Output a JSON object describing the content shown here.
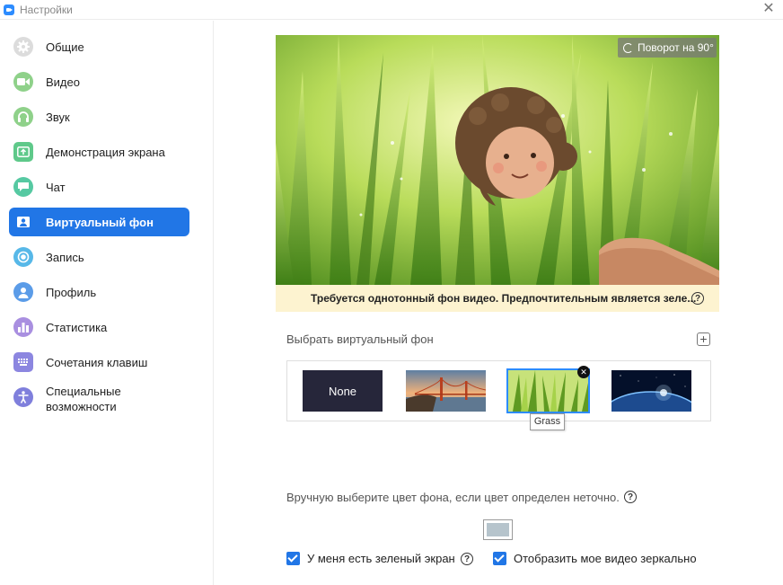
{
  "window": {
    "title": "Настройки"
  },
  "sidebar": {
    "items": [
      {
        "label": "Общие",
        "icon": "gear-icon",
        "color": "#dcdcdc",
        "active": false
      },
      {
        "label": "Видео",
        "icon": "video-camera-icon",
        "color": "#8fd18a",
        "active": false
      },
      {
        "label": "Звук",
        "icon": "headphones-icon",
        "color": "#8fd18a",
        "active": false
      },
      {
        "label": "Демонстрация экрана",
        "icon": "share-screen-icon",
        "color": "#5fc98a",
        "active": false
      },
      {
        "label": "Чат",
        "icon": "chat-bubble-icon",
        "color": "#56c9a2",
        "active": false
      },
      {
        "label": "Виртуальный фон",
        "icon": "person-card-icon",
        "color": "#2176e6",
        "active": true
      },
      {
        "label": "Запись",
        "icon": "record-icon",
        "color": "#57b8e8",
        "active": false
      },
      {
        "label": "Профиль",
        "icon": "person-icon",
        "color": "#5b9ce8",
        "active": false
      },
      {
        "label": "Статистика",
        "icon": "bar-chart-icon",
        "color": "#a98fe0",
        "active": false
      },
      {
        "label": "Сочетания клавиш",
        "icon": "keyboard-icon",
        "color": "#8c86e0",
        "active": false
      },
      {
        "label": "Специальные возможности",
        "icon": "accessibility-icon",
        "color": "#7f7fdc",
        "active": false
      }
    ]
  },
  "preview": {
    "rotate_label": "Поворот на 90°",
    "warning": "Требуется однотонный фон видео. Предпочтительным является зеле..."
  },
  "backgrounds": {
    "label": "Выбрать виртуальный фон",
    "items": [
      {
        "label": "None",
        "kind": "none"
      },
      {
        "label": "",
        "kind": "golden-gate-bridge"
      },
      {
        "label": "Grass",
        "kind": "grass",
        "selected": true
      },
      {
        "label": "",
        "kind": "earth-from-space"
      }
    ],
    "tooltip": "Grass",
    "accent": "#2d8cff"
  },
  "manual_color": {
    "label": "Вручную выберите цвет фона, если цвет определен неточно.",
    "swatch": "#b6c4cc"
  },
  "options": {
    "green_screen": "У меня есть зеленый экран",
    "mirror": "Отобразить мое видео зеркально"
  }
}
